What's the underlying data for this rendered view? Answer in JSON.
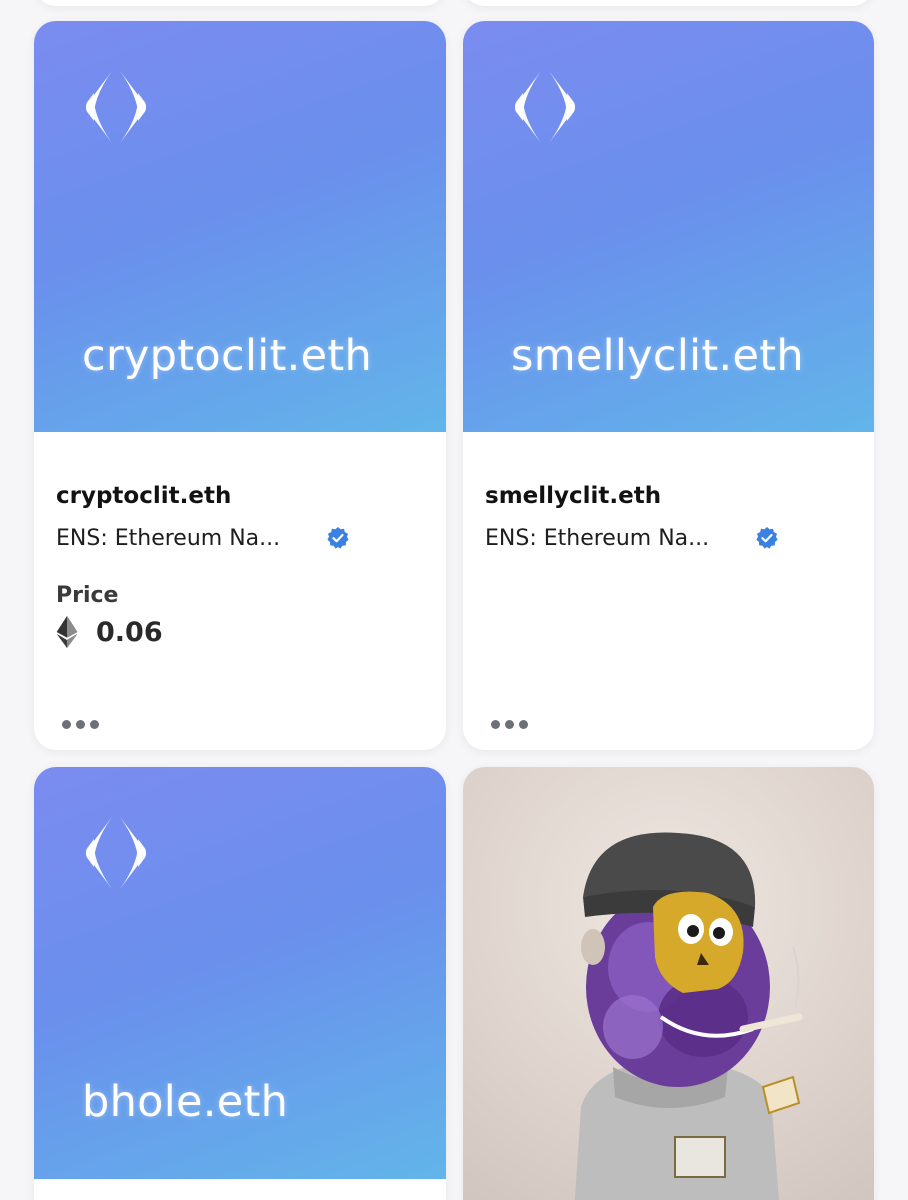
{
  "cards": [
    {
      "media_name": "cryptoclit.eth",
      "title": "cryptoclit.eth",
      "collection": "ENS: Ethereum Na...",
      "price_label": "Price",
      "price_value": "0.06",
      "price_currency_icon": "ethereum-icon",
      "more_icon": "more-dots-icon"
    },
    {
      "media_name": "smellyclit.eth",
      "title": "smellyclit.eth",
      "collection": "ENS: Ethereum Na...",
      "more_icon": "more-dots-icon"
    },
    {
      "media_name": "bhole.eth"
    },
    {
      "media_type": "nft-character-image"
    }
  ],
  "colors": {
    "ens_gradient_start": "#7b8cf0",
    "ens_gradient_end": "#62b5ea",
    "verified_badge": "#3b82e0"
  }
}
